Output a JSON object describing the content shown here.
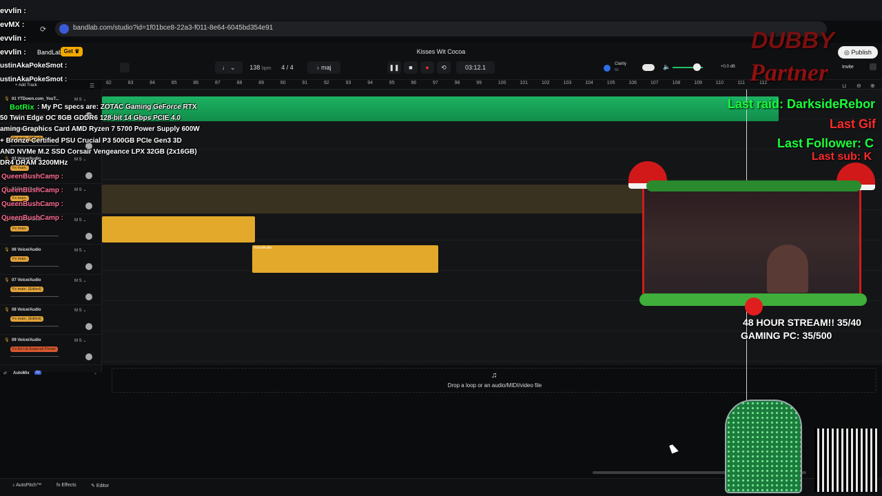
{
  "browser": {
    "url": "bandlab.com/studio?id=1f01bce8-22a3-f011-8e64-6045bd354e91"
  },
  "app": {
    "logo": "BandLab",
    "get_label": "Get",
    "song_title": "Kisses Wit Cocoa",
    "bpm_value": "138",
    "bpm_unit": "bpm",
    "time_sig": "4 / 4",
    "key": "maj",
    "time_display": "03:12.1",
    "clarity_label": "Clarity",
    "clarity_value": "50",
    "gain": "+0.0 dB",
    "publish_label": "Publish",
    "invite_label": "Invite",
    "add_track": "+ Add Track"
  },
  "ruler": {
    "bars": [
      "82",
      "83",
      "84",
      "85",
      "86",
      "87",
      "88",
      "89",
      "90",
      "91",
      "92",
      "93",
      "94",
      "95",
      "96",
      "97",
      "98",
      "99",
      "100",
      "101",
      "102",
      "103",
      "104",
      "105",
      "106",
      "107",
      "108",
      "109",
      "110",
      "111",
      "112"
    ]
  },
  "tracks": [
    {
      "num": "01",
      "name": "YTDown.com_YouT...",
      "fx": ""
    },
    {
      "num": "02",
      "name": "Voice/Audio",
      "fx": "Fx main. (Edited)"
    },
    {
      "num": "03",
      "name": "Voice/Audio",
      "fx": "Fx main."
    },
    {
      "num": "04",
      "name": "Voice/Audio",
      "fx": "Fx main."
    },
    {
      "num": "05",
      "name": "Voice/Audio",
      "fx": "Fx main."
    },
    {
      "num": "06",
      "name": "Voice/Audio",
      "fx": "Fx main."
    },
    {
      "num": "07",
      "name": "Voice/Audio",
      "fx": "Fx main. (Edited)"
    },
    {
      "num": "08",
      "name": "Voice/Audio",
      "fx": "Fx main. (Edited)"
    },
    {
      "num": "09",
      "name": "Voice/Audio",
      "fx": "Fx Ad Lib Especial Preset"
    }
  ],
  "track_buttons": {
    "mute": "M",
    "solo": "S"
  },
  "clips": {
    "clip6_label": "Voice/Audio"
  },
  "automix": {
    "label": "AutoMix",
    "badge": "AI"
  },
  "dropzone": {
    "text": "Drop a loop or an audio/MIDI/video file"
  },
  "bottom": {
    "autopitch": "AutoPitch™",
    "effects": "Effects",
    "editor": "Editor"
  },
  "stream_overlay": {
    "chat": [
      {
        "user": "evvlin :",
        "text": ""
      },
      {
        "user": "evMX :",
        "text": ""
      },
      {
        "user": "evvlin :",
        "text": ""
      },
      {
        "user": "evvlin :",
        "text": ""
      },
      {
        "user": "ustinAkaPokeSmot :",
        "text": ""
      },
      {
        "user": "ustinAkaPokeSmot :",
        "text": ""
      }
    ],
    "botrix_user": "BotRix",
    "botrix_lines": [
      ": My PC specs are: ZOTAC Gaming GeForce RTX",
      "50 Twin Edge OC 8GB GDDR6 128-bit 14 Gbps PCIE 4.0",
      "aming Graphics Card AMD Ryzen 7 5700 Power Supply 600W",
      "+ Bronze Certified PSU Crucial P3 500GB PCIe Gen3 3D",
      "AND NVMe M.2 SSD Corsair Vengeance LPX 32GB (2x16GB)",
      "DR4 DRAM 3200MHz"
    ],
    "queen_lines": [
      "QueenBushCamp :",
      "QueenBushCamp :",
      "QueenBushCamp :",
      "QueenBushCamp :"
    ],
    "brand_top": "DUBBY",
    "brand_bottom": "Partner",
    "last_raid": "Last raid: DarksideRebor",
    "last_gift": "Last Gif",
    "last_follower": "Last Follower: C",
    "last_sub": "Last sub: K",
    "stream_goal": "48 HOUR STREAM!! 35/40",
    "pc_goal": "GAMING PC: 35/500"
  },
  "colors": {
    "accent_green": "#1ec46b",
    "clip_yellow": "#e3a92a",
    "record_red": "#e8332a",
    "chat_pink": "#ff6f96",
    "overlay_green": "#1aff3a",
    "overlay_red": "#ff2a2a"
  }
}
